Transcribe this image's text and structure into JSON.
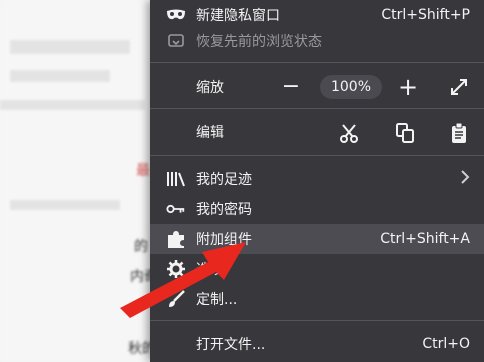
{
  "menu": {
    "private_window": {
      "label": "新建隐私窗口",
      "shortcut": "Ctrl+Shift+P",
      "icon": "mask-icon"
    },
    "restore_session": {
      "label": "恢复先前的浏览状态",
      "icon": "restore-icon"
    },
    "zoom": {
      "label": "缩放",
      "minus": "−",
      "value": "100%",
      "plus": "+",
      "icon": "fullscreen-icon"
    },
    "edit": {
      "label": "编辑",
      "icons": [
        "scissors-icon",
        "copy-icon",
        "clipboard-icon"
      ]
    },
    "library": {
      "label": "我的足迹",
      "icon": "library-icon"
    },
    "passwords": {
      "label": "我的密码",
      "icon": "key-icon"
    },
    "addons": {
      "label": "附加组件",
      "shortcut": "Ctrl+Shift+A",
      "icon": "puzzle-icon"
    },
    "options": {
      "label": "选项",
      "icon": "gear-icon"
    },
    "customize": {
      "label": "定制...",
      "icon": "brush-icon"
    },
    "open_file": {
      "label": "打开文件...",
      "shortcut": "Ctrl+O"
    }
  },
  "background": {
    "snippets": [
      "最",
      "的",
      "内奇",
      "秋的"
    ]
  },
  "colors": {
    "menu_bg": "#38373c",
    "highlight": "#4d4c53",
    "arrow": "#e8271e"
  }
}
